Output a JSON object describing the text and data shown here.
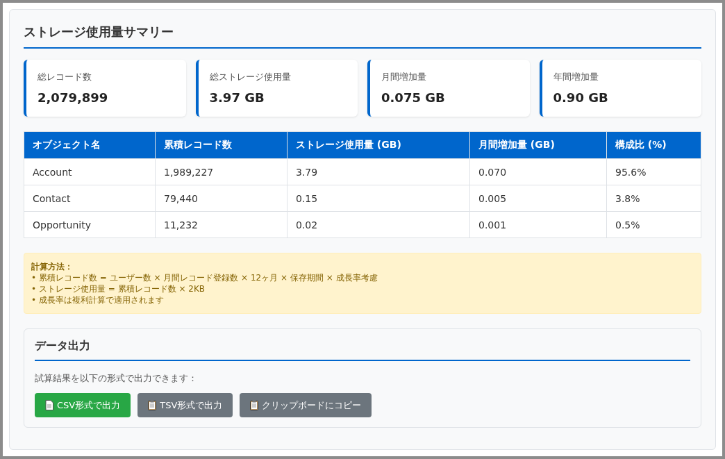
{
  "title": "ストレージ使用量サマリー",
  "cards": [
    {
      "label": "総レコード数",
      "value": "2,079,899"
    },
    {
      "label": "総ストレージ使用量",
      "value": "3.97 GB"
    },
    {
      "label": "月間増加量",
      "value": "0.075 GB"
    },
    {
      "label": "年間増加量",
      "value": "0.90 GB"
    }
  ],
  "table": {
    "columns": [
      "オブジェクト名",
      "累積レコード数",
      "ストレージ使用量 (GB)",
      "月間増加量 (GB)",
      "構成比 (%)"
    ],
    "rows": [
      [
        "Account",
        "1,989,227",
        "3.79",
        "0.070",
        "95.6%"
      ],
      [
        "Contact",
        "79,440",
        "0.15",
        "0.005",
        "3.8%"
      ],
      [
        "Opportunity",
        "11,232",
        "0.02",
        "0.001",
        "0.5%"
      ]
    ]
  },
  "note": {
    "heading": "計算方法：",
    "lines": [
      "• 累積レコード数 = ユーザー数 × 月間レコード登録数 × 12ヶ月 × 保存期間 × 成長率考慮",
      "• ストレージ使用量 = 累積レコード数 × 2KB",
      "• 成長率は複利計算で適用されます"
    ]
  },
  "export": {
    "title": "データ出力",
    "description": "試算結果を以下の形式で出力できます：",
    "buttons": [
      {
        "label": "CSV形式で出力",
        "kind": "document",
        "color": "#28a745"
      },
      {
        "label": "TSV形式で出力",
        "kind": "clipboard",
        "color": "#6c757d"
      },
      {
        "label": "クリップボードにコピー",
        "kind": "clipboard",
        "color": "#6c757d"
      }
    ]
  }
}
